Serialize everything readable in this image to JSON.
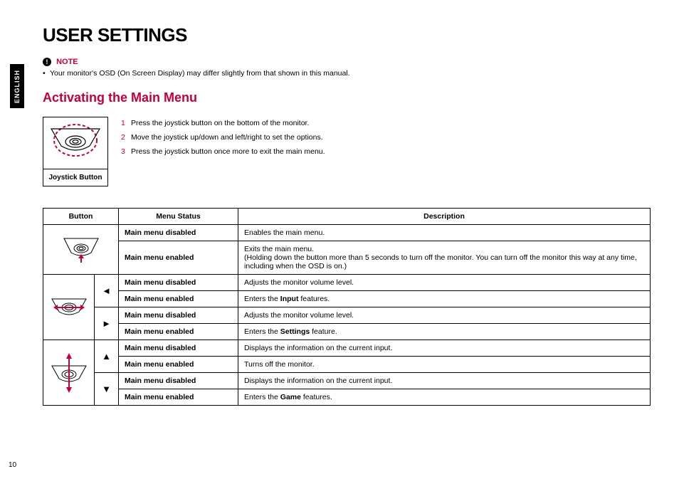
{
  "side_tab": "ENGLISH",
  "page_number": "10",
  "h1": "USER SETTINGS",
  "note": {
    "label": "NOTE",
    "bullet": "Your monitor's OSD (On Screen Display) may differ slightly from that shown in this manual."
  },
  "h2": "Activating the Main Menu",
  "joystick_caption": "Joystick Button",
  "steps": [
    "Press the joystick button on the bottom of the monitor.",
    "Move the joystick up/down and left/right to set the options.",
    "Press the joystick button once more to exit the main menu."
  ],
  "table": {
    "headers": {
      "button": "Button",
      "status": "Menu Status",
      "desc": "Description"
    },
    "group1": {
      "r1": {
        "status": "Main menu disabled",
        "desc": "Enables the main menu."
      },
      "r2": {
        "status": "Main menu enabled",
        "desc_l1": "Exits the main menu.",
        "desc_l2": "(Holding down the button more than 5 seconds to turn off the monitor. You can turn off the monitor this way at any time, including when the OSD is on.)"
      }
    },
    "group2": {
      "left": {
        "r1": {
          "status": "Main menu disabled",
          "desc": "Adjusts the monitor volume level."
        },
        "r2": {
          "status": "Main menu enabled",
          "pre": "Enters the ",
          "b": "Input",
          "post": " features."
        }
      },
      "right": {
        "r1": {
          "status": "Main menu disabled",
          "desc": "Adjusts the monitor volume level."
        },
        "r2": {
          "status": "Main menu enabled",
          "pre": "Enters the ",
          "b": "Settings",
          "post": " feature."
        }
      }
    },
    "group3": {
      "up": {
        "r1": {
          "status": "Main menu disabled",
          "desc": "Displays the information on the current input."
        },
        "r2": {
          "status": "Main menu enabled",
          "desc": "Turns off the monitor."
        }
      },
      "down": {
        "r1": {
          "status": "Main menu disabled",
          "desc": "Displays the information on the current input."
        },
        "r2": {
          "status": "Main menu enabled",
          "pre": "Enters the ",
          "b": "Game",
          "post": " features."
        }
      }
    }
  }
}
